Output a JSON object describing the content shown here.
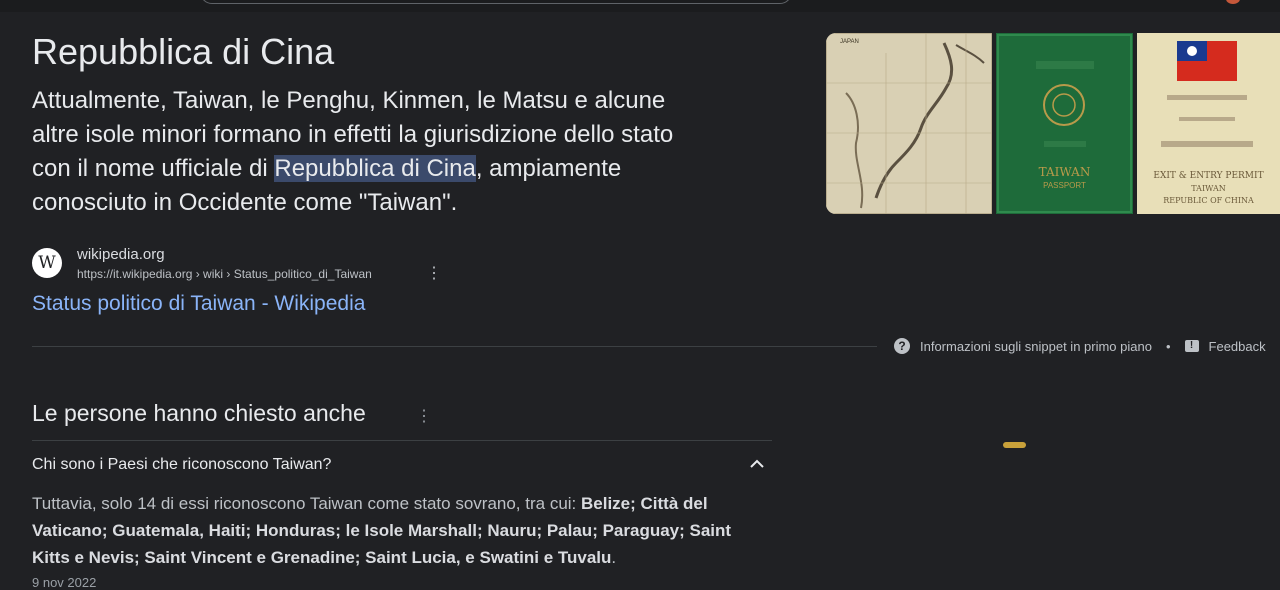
{
  "snippet": {
    "title": "Repubblica di Cina",
    "text_before": "Attualmente, Taiwan, le Penghu, Kinmen, le Matsu e alcune altre isole minori formano in effetti la giurisdizione dello stato con il nome ufficiale di ",
    "text_highlight": "Repubblica di Cina",
    "text_after": ", ampiamente conosciuto in Occidente come \"Taiwan\"."
  },
  "images": [
    {
      "icon": "map-of-japan-taiwan",
      "label": "JAPAN"
    },
    {
      "icon": "taiwan-passport",
      "line1": "TAIWAN",
      "line2": "PASSPORT"
    },
    {
      "icon": "roc-entry-permit",
      "line1": "EXIT & ENTRY PERMIT",
      "line2": "TAIWAN",
      "line3": "REPUBLIC OF CHINA"
    }
  ],
  "source": {
    "favicon": "W",
    "site_name": "wikipedia.org",
    "url": "https://it.wikipedia.org › wiki › Status_politico_di_Taiwan",
    "link_title": "Status politico di Taiwan - Wikipedia"
  },
  "snippet_footer": {
    "info_label": "Informazioni sugli snippet in primo piano",
    "feedback_label": "Feedback"
  },
  "paa": {
    "title": "Le persone hanno chiesto anche",
    "question": "Chi sono i Paesi che riconoscono Taiwan?",
    "answer_intro": "Tuttavia, solo 14 di essi riconoscono Taiwan come stato sovrano, tra cui: ",
    "answer_bold": "Belize; Città del Vaticano; Guatemala, Haiti; Honduras; le Isole Marshall; Nauru; Palau; Paraguay; Saint Kitts e Nevis; Saint Vincent e Grenadine; Saint Lucia, e Swatini e Tuvalu",
    "answer_end": ".",
    "date": "9 nov 2022"
  },
  "colors": {
    "background": "#202124",
    "link": "#8ab4f8",
    "highlight": "#3b4a6b"
  }
}
